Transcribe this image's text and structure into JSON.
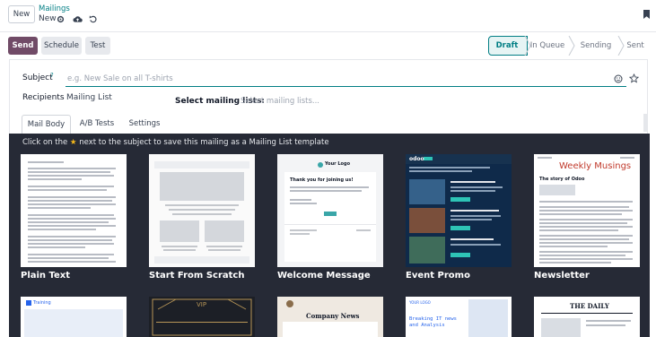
{
  "header": {
    "new_label": "New",
    "breadcrumb_parent": "Mailings",
    "breadcrumb_current": "New",
    "icons": [
      "gear-icon",
      "cloud-upload-icon",
      "undo-icon",
      "bookmark-icon"
    ]
  },
  "actions": {
    "send": "Send",
    "schedule": "Schedule",
    "test": "Test"
  },
  "status": {
    "steps": [
      "Draft",
      "In Queue",
      "Sending",
      "Sent"
    ],
    "active": "Draft"
  },
  "form": {
    "subject_label": "Subject",
    "subject_help": "?",
    "subject_placeholder": "e.g. New Sale on all T-shirts",
    "recipients_label": "Recipients",
    "recipients_value": "Mailing List",
    "select_lists_label": "Select mailing lists:",
    "select_lists_placeholder": "Select mailing lists..."
  },
  "tabs": [
    "Mail Body",
    "A/B Tests",
    "Settings"
  ],
  "templates": {
    "hint_before": "Click on the",
    "hint_after": "next to the subject to save this mailing as a Mailing List template",
    "items": [
      {
        "label": "Plain Text"
      },
      {
        "label": "Start From Scratch"
      },
      {
        "label": "Welcome Message",
        "logo": "Your Logo",
        "heading": "Thank you for joining us!"
      },
      {
        "label": "Event Promo",
        "brand": "odoo"
      },
      {
        "label": "Newsletter",
        "heading": "Weekly Musings",
        "story": "The story of Odoo"
      }
    ],
    "second_row": [
      {
        "label": "Training"
      },
      {
        "label": "VIP"
      },
      {
        "label": "Company News"
      },
      {
        "label": "Breaking IT news and Analysis",
        "logo": "YOUR LOGO"
      },
      {
        "label": "THE DAILY"
      }
    ]
  },
  "colors": {
    "primary": "#714b67",
    "accent": "#017e84",
    "dark_bg": "#262a36",
    "star": "#f3b71b"
  }
}
